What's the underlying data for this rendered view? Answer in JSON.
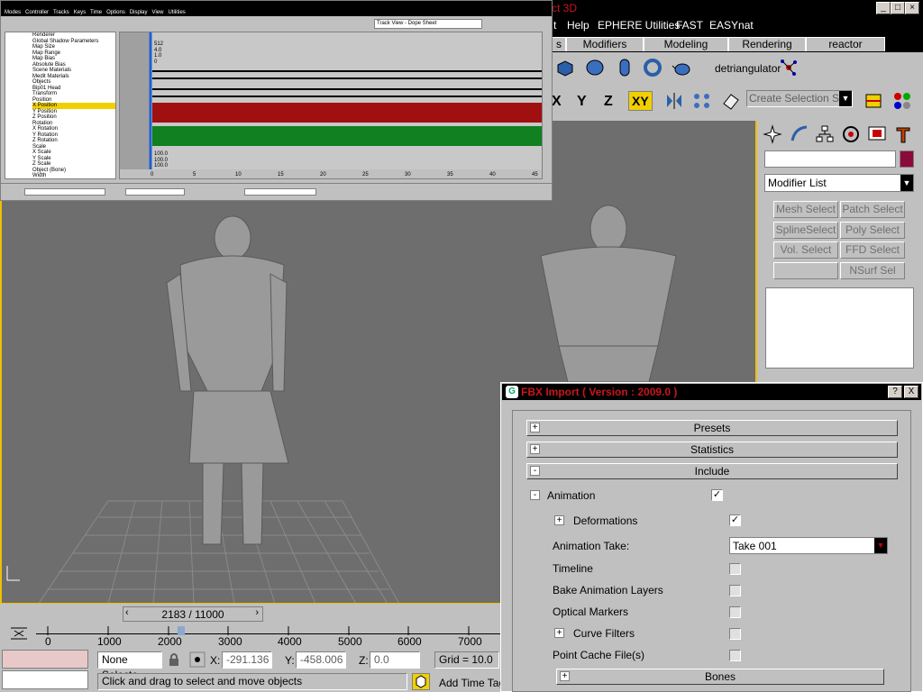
{
  "app": {
    "title_fragment": "ct 3D",
    "menu": [
      "t",
      "Help",
      "EPHERE Utilities",
      "FAST",
      "EASYnat"
    ]
  },
  "command_panel": {
    "tabs": [
      "s",
      "Modifiers",
      "Modeling",
      "Rendering",
      "reactor"
    ],
    "tool_label": "detriangulator",
    "axis_buttons": [
      "X",
      "Y",
      "Z",
      "XY"
    ],
    "selection_set_placeholder": "Create Selection Set",
    "modifier_list": "Modifier List",
    "modifier_buttons": [
      "Mesh Select",
      "Patch Select",
      "SplineSelect",
      "Poly Select",
      "Vol. Select",
      "FFD Select",
      "",
      "NSurf Sel"
    ],
    "color_swatch": "#8b0a3a"
  },
  "trackview": {
    "title": "Track View - Dope Sheet",
    "menus": [
      "Modes",
      "Controller",
      "Tracks",
      "Keys",
      "Time",
      "Options",
      "Display",
      "View",
      "Utilities"
    ],
    "tree": [
      "Renderer",
      "Global Shadow Parameters",
      "Map Size",
      "Map Range",
      "Map Bias",
      "Absolute Bias",
      "Scene Materials",
      "Medit Materials",
      "Objects",
      "Bip01 Head",
      "Transform",
      "Position",
      "X Position",
      "Y Position",
      "Z Position",
      "Rotation",
      "X Rotation",
      "Y Rotation",
      "Z Rotation",
      "Scale",
      "X Scale",
      "Y Scale",
      "Z Scale",
      "Object (Bone)",
      "Width"
    ],
    "values_top": [
      "512",
      "4.0",
      "1.0",
      "0"
    ],
    "values_bottom": [
      "100.0",
      "100.0",
      "100.0"
    ],
    "ruler": [
      "0",
      "5",
      "10",
      "15",
      "20",
      "25",
      "30",
      "35",
      "40",
      "45"
    ]
  },
  "timeline": {
    "frame_display": "2183 / 11000",
    "ruler": [
      "0",
      "1000",
      "2000",
      "3000",
      "4000",
      "5000",
      "6000",
      "7000"
    ]
  },
  "status": {
    "selection": "None Selecte",
    "x_label": "X:",
    "x_value": "-291.136",
    "y_label": "Y:",
    "y_value": "-458.006",
    "z_label": "Z:",
    "z_value": "0.0",
    "grid": "Grid = 10.0",
    "prompt": "Click and drag to select and move objects",
    "add_time_tag": "Add Time Tag"
  },
  "fbx_dialog": {
    "title": "FBX Import ( Version : 2009.0 )",
    "rollouts": [
      "Presets",
      "Statistics",
      "Include"
    ],
    "animation_label": "Animation",
    "options": [
      {
        "label": "Deformations",
        "checked": true
      },
      {
        "label": "Animation Take:",
        "checked": false
      },
      {
        "label": "Timeline",
        "checked": false
      },
      {
        "label": "Bake Animation Layers",
        "checked": false
      },
      {
        "label": "Optical Markers",
        "checked": false
      },
      {
        "label": "Curve Filters",
        "checked": false
      },
      {
        "label": "Point Cache File(s)",
        "checked": false
      }
    ],
    "take_value": "Take 001",
    "bones_label": "Bones",
    "help_button": "?",
    "close_button": "X"
  }
}
